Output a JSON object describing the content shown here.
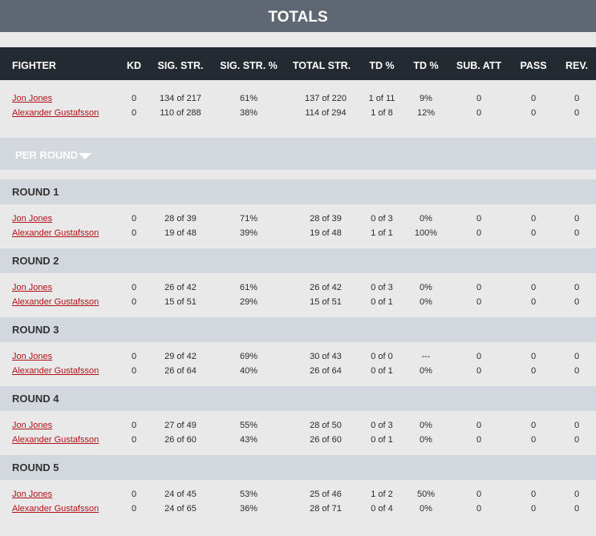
{
  "title": "TOTALS",
  "headers": [
    "FIGHTER",
    "KD",
    "SIG. STR.",
    "SIG. STR. %",
    "TOTAL STR.",
    "TD %",
    "TD %",
    "SUB. ATT",
    "PASS",
    "REV."
  ],
  "totals": [
    {
      "fighter": "Jon Jones",
      "kd": "0",
      "sig": "134 of 217",
      "sigpct": "61%",
      "total": "137 of 220",
      "td": "1 of 11",
      "tdpct": "9%",
      "sub": "0",
      "pass": "0",
      "rev": "0"
    },
    {
      "fighter": "Alexander Gustafsson",
      "kd": "0",
      "sig": "110 of 288",
      "sigpct": "38%",
      "total": "114 of 294",
      "td": "1 of 8",
      "tdpct": "12%",
      "sub": "0",
      "pass": "0",
      "rev": "0"
    }
  ],
  "per_round_label": "PER ROUND",
  "rounds": [
    {
      "label": "ROUND 1",
      "rows": [
        {
          "fighter": "Jon Jones",
          "kd": "0",
          "sig": "28 of 39",
          "sigpct": "71%",
          "total": "28 of 39",
          "td": "0 of 3",
          "tdpct": "0%",
          "sub": "0",
          "pass": "0",
          "rev": "0"
        },
        {
          "fighter": "Alexander Gustafsson",
          "kd": "0",
          "sig": "19 of 48",
          "sigpct": "39%",
          "total": "19 of 48",
          "td": "1 of 1",
          "tdpct": "100%",
          "sub": "0",
          "pass": "0",
          "rev": "0"
        }
      ]
    },
    {
      "label": "ROUND 2",
      "rows": [
        {
          "fighter": "Jon Jones",
          "kd": "0",
          "sig": "26 of 42",
          "sigpct": "61%",
          "total": "26 of 42",
          "td": "0 of 3",
          "tdpct": "0%",
          "sub": "0",
          "pass": "0",
          "rev": "0"
        },
        {
          "fighter": "Alexander Gustafsson",
          "kd": "0",
          "sig": "15 of 51",
          "sigpct": "29%",
          "total": "15 of 51",
          "td": "0 of 1",
          "tdpct": "0%",
          "sub": "0",
          "pass": "0",
          "rev": "0"
        }
      ]
    },
    {
      "label": "ROUND 3",
      "rows": [
        {
          "fighter": "Jon Jones",
          "kd": "0",
          "sig": "29 of 42",
          "sigpct": "69%",
          "total": "30 of 43",
          "td": "0 of 0",
          "tdpct": "---",
          "sub": "0",
          "pass": "0",
          "rev": "0"
        },
        {
          "fighter": "Alexander Gustafsson",
          "kd": "0",
          "sig": "26 of 64",
          "sigpct": "40%",
          "total": "26 of 64",
          "td": "0 of 1",
          "tdpct": "0%",
          "sub": "0",
          "pass": "0",
          "rev": "0"
        }
      ]
    },
    {
      "label": "ROUND 4",
      "rows": [
        {
          "fighter": "Jon Jones",
          "kd": "0",
          "sig": "27 of 49",
          "sigpct": "55%",
          "total": "28 of 50",
          "td": "0 of 3",
          "tdpct": "0%",
          "sub": "0",
          "pass": "0",
          "rev": "0"
        },
        {
          "fighter": "Alexander Gustafsson",
          "kd": "0",
          "sig": "26 of 60",
          "sigpct": "43%",
          "total": "26 of 60",
          "td": "0 of 1",
          "tdpct": "0%",
          "sub": "0",
          "pass": "0",
          "rev": "0"
        }
      ]
    },
    {
      "label": "ROUND 5",
      "rows": [
        {
          "fighter": "Jon Jones",
          "kd": "0",
          "sig": "24 of 45",
          "sigpct": "53%",
          "total": "25 of 46",
          "td": "1 of 2",
          "tdpct": "50%",
          "sub": "0",
          "pass": "0",
          "rev": "0"
        },
        {
          "fighter": "Alexander Gustafsson",
          "kd": "0",
          "sig": "24 of 65",
          "sigpct": "36%",
          "total": "28 of 71",
          "td": "0 of 4",
          "tdpct": "0%",
          "sub": "0",
          "pass": "0",
          "rev": "0"
        }
      ]
    }
  ]
}
